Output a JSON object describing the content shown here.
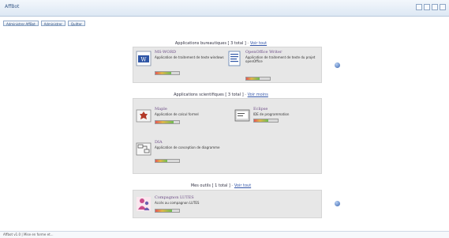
{
  "window": {
    "title": "AffBot"
  },
  "toolbar": {
    "buttons": [
      "Administrer AffBot",
      "Administrer",
      "Quitter"
    ]
  },
  "sections": [
    {
      "title": "Applications bureautiques [ 3 total ]",
      "separator": "-",
      "link": "Voir tout",
      "apps": [
        {
          "name": "MS-WORD",
          "desc": "Application de traitement de texte windows",
          "rating": 0.65
        },
        {
          "name": "OpenOffice Writer",
          "desc": "Application de traitement de texte du projet openOffice",
          "rating": 0.55
        }
      ]
    },
    {
      "title": "Applications scientifiques [ 3 total ]",
      "separator": "-",
      "link": "Voir moins",
      "apps": [
        {
          "name": "Maple",
          "desc": "Application de calcul formel",
          "rating": 0.75
        },
        {
          "name": "Eclipse",
          "desc": "IDE de programmation",
          "rating": 0.6
        },
        {
          "name": "DIA",
          "desc": "Application de conception de diagramme",
          "rating": 0.5
        }
      ]
    },
    {
      "title": "Mes outils [ 1 total ]",
      "separator": "-",
      "link": "Voir tout",
      "apps": [
        {
          "name": "Compagnon LUTES",
          "desc": "Accès au compagnon LUTES",
          "rating": 0.7
        }
      ]
    }
  ],
  "footer": {
    "text": "Affbot v1.0 | Mise en forme et..."
  },
  "icons": {
    "ms-word": "word-icon",
    "openoffice-writer": "writer-icon",
    "maple": "maple-icon",
    "eclipse": "eclipse-icon",
    "dia": "dia-icon",
    "compagnon": "compagnon-icon",
    "info": "info-icon"
  },
  "colors": {
    "panel": "#e7e7e7",
    "link": "#3456a8",
    "app_name": "#6c4c86",
    "titlebar": "#dde8f4"
  }
}
